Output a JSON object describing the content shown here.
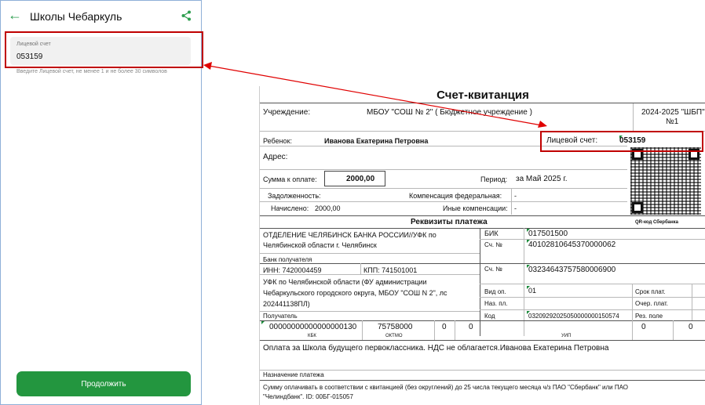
{
  "app": {
    "title": "Школы Чебаркуль",
    "field_label": "Лицевой счет",
    "field_value": "053159",
    "hint": "Введите Лицевой счет, не менее 1 и не более 30 символов",
    "continue_label": "Продолжить"
  },
  "receipt": {
    "title": "Счет-квитанция",
    "institution_label": "Учреждение:",
    "institution": "МБОУ \"СОШ № 2\" ( Бюджетное учреждение )",
    "year": "2024-2025 \"ШБП\"",
    "group": "№1",
    "child_label": "Ребенок:",
    "child": "Иванова Екатерина Петровна",
    "account_label": "Лицевой счет:",
    "account": "053159",
    "address_label": "Адрес:",
    "sum_label": "Сумма к оплате:",
    "sum": "2000,00",
    "period_label": "Период:",
    "period": "за Май 2025 г.",
    "debt_label": "Задолженность:",
    "debt": "-",
    "fed_comp_label": "Компенсация федеральная:",
    "fed_comp": "-",
    "accrued_label": "Начислено:",
    "accrued": "2000,00",
    "other_comp_label": "Иные компенсации:",
    "other_comp": "-",
    "requisites_title": "Реквизиты платежа",
    "qr_label": "QR-код Сбербанка",
    "bank_line1": "ОТДЕЛЕНИЕ ЧЕЛЯБИНСК БАНКА РОССИИ//УФК по",
    "bank_line2": "Челябинской области г. Челябинск",
    "bank_recipient_label": "Банк получателя",
    "bik_label": "БИК",
    "bik": "017501500",
    "acc1_label": "Сч. №",
    "acc1": "40102810645370000062",
    "inn": "ИНН: 7420004459",
    "kpp": "КПП: 741501001",
    "acc2_label": "Сч. №",
    "acc2": "03234643757580006900",
    "recipient_line1": "УФК по Челябинской области (ФУ администрации",
    "recipient_line2": "Чебаркульского городского округа, МБОУ \"СОШ N 2\", лс",
    "recipient_line3": "202441138ПЛ)",
    "recipient_label": "Получатель",
    "vid_op_label": "Вид оп.",
    "vid_op": "01",
    "naz_pl_label": "Наз. пл.",
    "kod_label": "Код",
    "kod": "03209292025050000000150574",
    "srok_label": "Срок плат.",
    "ocher_label": "Очер. плат.",
    "rez_label": "Рез. поле",
    "kbk": "00000000000000000130",
    "kbk_label": "КБК",
    "oktmo": "75758000",
    "oktmo_label": "ОКТМО",
    "zero1": "0",
    "zero2": "0",
    "uip_label": "УИП",
    "zero3": "0",
    "zero4": "0",
    "purpose": "Оплата за Школа будущего первоклассника. НДС не облагается.Иванова Екатерина Петровна",
    "purpose_label": "Назначение платежа",
    "footer_line1": "Сумму оплачивать в соответствии с квитанцией (без округлений) до 25 числа текущего месяца ч/з ПАО \"Сбербанк\" или ПАО",
    "footer_line2": "\"Челиндбанк\". ID: 00БГ-015057"
  },
  "colors": {
    "accent": "#23963f",
    "highlight": "#c00000",
    "phone_border": "#8fb0d8"
  },
  "icons": [
    "back-arrow-icon",
    "share-icon",
    "qr-code"
  ]
}
